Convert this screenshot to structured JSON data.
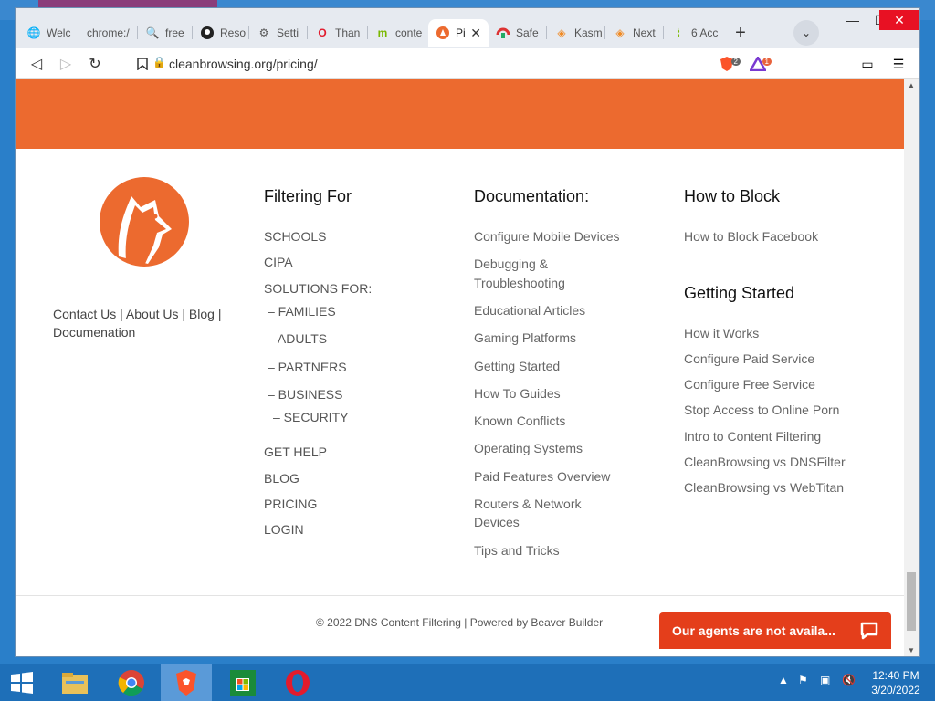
{
  "browser": {
    "tabs": [
      {
        "label": "Welc",
        "icon": "globe-icon"
      },
      {
        "label": "chrome:/",
        "icon": ""
      },
      {
        "label": "free",
        "icon": "search-icon"
      },
      {
        "label": "Reso",
        "icon": "github-icon"
      },
      {
        "label": "Setti",
        "icon": "gear-icon"
      },
      {
        "label": "Than",
        "icon": "opera-icon"
      },
      {
        "label": "conte",
        "icon": "m-icon"
      },
      {
        "label": "Pi",
        "icon": "cleanbrowsing-icon",
        "active": true
      },
      {
        "label": "Safe",
        "icon": "safe-icon"
      },
      {
        "label": "Kasm",
        "icon": "kasm-icon"
      },
      {
        "label": "Next",
        "icon": "kasm-icon"
      },
      {
        "label": "6 Acc",
        "icon": "leaf-icon"
      }
    ],
    "url": "cleanbrowsing.org/pricing/",
    "brave_badge": "2",
    "rewards_badge": "1"
  },
  "footer": {
    "about_links": {
      "contact": "Contact Us",
      "sep1": " | ",
      "about": "About Us",
      "sep2": " | ",
      "blog": "Blog",
      "sep3": " |",
      "docs": "Documenation"
    },
    "filtering": {
      "heading": "Filtering For",
      "schools": "SCHOOLS",
      "cipa": "CIPA",
      "solutions": "SOLUTIONS FOR:",
      "families": "– FAMILIES",
      "adults": "– ADULTS",
      "partners": "– PARTNERS",
      "business": "– BUSINESS",
      "security": "– SECURITY",
      "help": "GET HELP",
      "blog": "BLOG",
      "pricing": "PRICING",
      "login": "LOGIN"
    },
    "documentation": {
      "heading": "Documentation:",
      "items": [
        "Configure Mobile Devices",
        "Debugging &",
        "Troubleshooting",
        "Educational Articles",
        "Gaming Platforms",
        "Getting Started",
        "How To Guides",
        "Known Conflicts",
        "Operating Systems",
        "Paid Features Overview",
        "Routers & Network",
        "Devices",
        "Tips and Tricks"
      ]
    },
    "how_to_block": {
      "heading": "How to Block",
      "facebook": "How to Block Facebook"
    },
    "getting_started": {
      "heading": "Getting Started",
      "items": [
        "How it Works",
        "Configure Paid Service",
        "Configure Free Service",
        "Stop Access to Online Porn",
        "Intro to Content Filtering",
        "CleanBrowsing vs DNSFilter",
        "CleanBrowsing vs WebTitan"
      ]
    },
    "copyright": "© 2022 DNS Content Filtering | Powered by Beaver Builder",
    "chat_label": "Our agents are not availa..."
  },
  "taskbar": {
    "time": "12:40 PM",
    "date": "3/20/2022"
  },
  "colors": {
    "brand_orange": "#ec6a2f",
    "chat_red": "#e43e1b",
    "taskbar_blue": "#1e6fb8"
  }
}
